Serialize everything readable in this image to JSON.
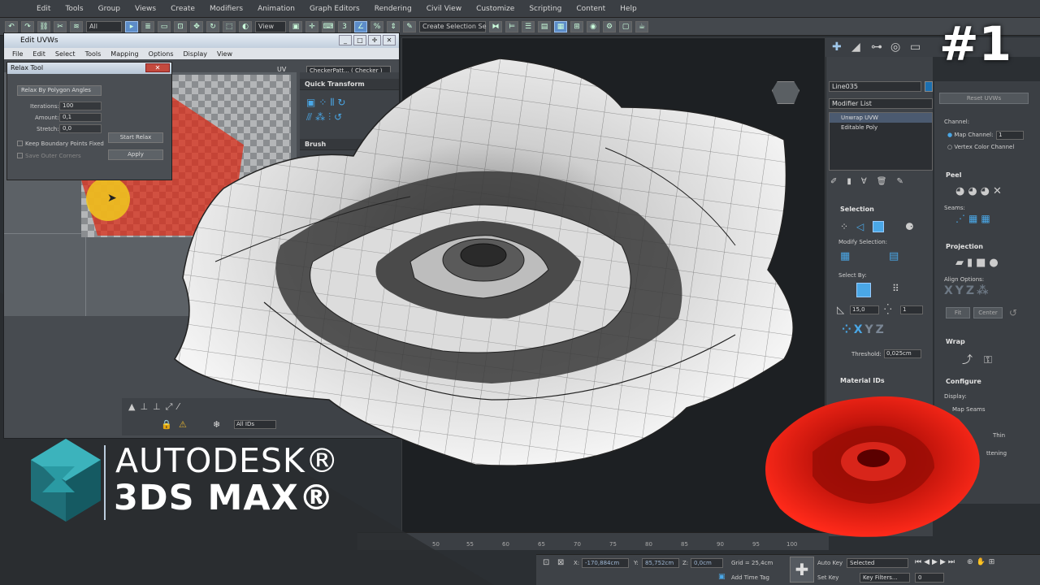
{
  "menu": [
    "Edit",
    "Tools",
    "Group",
    "Views",
    "Create",
    "Modifiers",
    "Animation",
    "Graph Editors",
    "Rendering",
    "Civil View",
    "Customize",
    "Scripting",
    "Content",
    "Help"
  ],
  "toolbar": {
    "filter_select": "All",
    "view_select": "View",
    "selection_set": "Create Selection Se"
  },
  "edit_uvw": {
    "title": "Edit UVWs",
    "menu": [
      "File",
      "Edit",
      "Select",
      "Tools",
      "Mapping",
      "Options",
      "Display",
      "View"
    ],
    "uv_label": "UV",
    "checker_select": "CheckerPatt... ( Checker )",
    "quick_transform": "Quick Transform",
    "brush": "Brush",
    "bottom_select": "All IDs"
  },
  "relax_tool": {
    "title": "Relax Tool",
    "method": "Relax By Polygon Angles",
    "iterations_label": "Iterations:",
    "iterations_value": "100",
    "amount_label": "Amount:",
    "amount_value": "0,1",
    "stretch_label": "Stretch:",
    "stretch_value": "0,0",
    "keep_boundary": "Keep Boundary Points Fixed",
    "save_outer": "Save Outer Corners",
    "start_relax": "Start Relax",
    "apply": "Apply"
  },
  "command_panel": {
    "object_name": "Line035",
    "modifier_list": "Modifier List",
    "stack": [
      "Unwrap UVW",
      "Editable Poly"
    ],
    "selection": "Selection",
    "modify_selection": "Modify Selection:",
    "select_by": "Select By:",
    "angle_value": "15,0",
    "count_value": "1",
    "threshold_label": "Threshold:",
    "threshold_value": "0,025cm",
    "material_ids": "Material IDs",
    "reset_uvws": "Reset UVWs",
    "channel": "Channel:",
    "map_channel": "Map Channel:",
    "map_channel_value": "1",
    "vertex_color": "Vertex Color Channel",
    "peel": "Peel",
    "seams": "Seams:",
    "projection": "Projection",
    "align_options": "Align Options:",
    "fit": "Fit",
    "center": "Center",
    "wrap": "Wrap",
    "configure": "Configure",
    "display": "Display:",
    "map_seams": "Map Seams",
    "thin": "Thin",
    "flattening": "ttening"
  },
  "timeline_ticks": [
    "50",
    "55",
    "60",
    "65",
    "70",
    "75",
    "80",
    "85",
    "90",
    "95",
    "100"
  ],
  "status": {
    "x_label": "X:",
    "x_value": "-170,884cm",
    "y_label": "Y:",
    "y_value": "85,752cm",
    "z_label": "Z:",
    "z_value": "0,0cm",
    "grid": "Grid = 25,4cm",
    "add_time_tag": "Add Time Tag",
    "auto_key": "Auto Key",
    "set_key": "Set Key",
    "selected": "Selected",
    "key_filters": "Key Filters...",
    "frame": "0"
  },
  "branding": {
    "line1": "AUTODESK®",
    "line2": "3DS MAX®",
    "episode": "#1"
  },
  "colors": {
    "logo_teal": "#2a9aa3",
    "rose_red": "#d21a10",
    "accent_blue": "#4aa7e6"
  }
}
